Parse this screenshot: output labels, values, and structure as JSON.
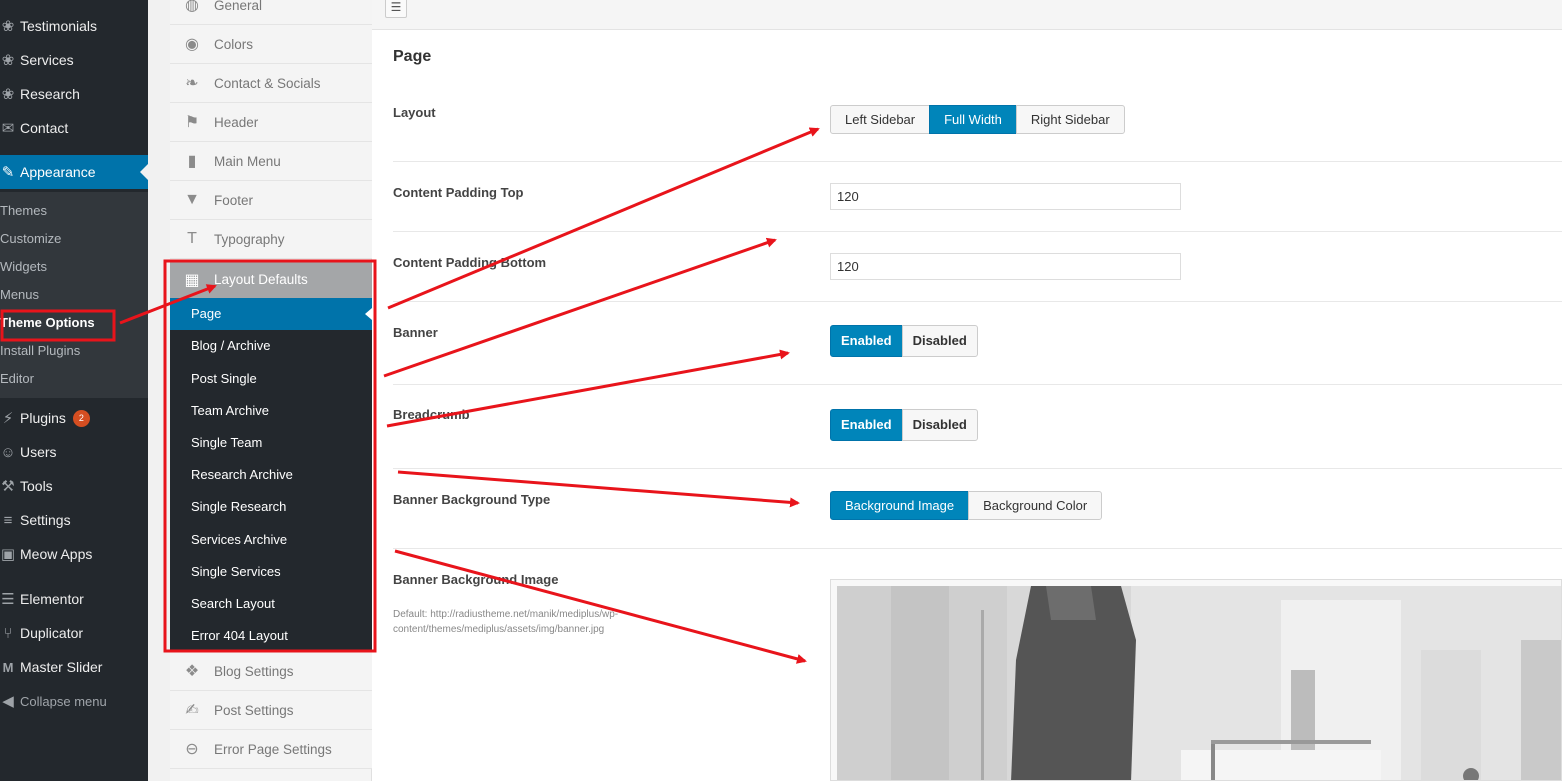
{
  "wp_menu": {
    "items_top": [
      {
        "label": "Testimonials",
        "icon": "award-icon"
      },
      {
        "label": "Services",
        "icon": "award-icon"
      },
      {
        "label": "Research",
        "icon": "award-icon"
      },
      {
        "label": "Contact",
        "icon": "mail-icon"
      }
    ],
    "active": {
      "label": "Appearance",
      "icon": "paintbrush-icon"
    },
    "submenu": [
      "Themes",
      "Customize",
      "Widgets",
      "Menus",
      "Theme Options",
      "Install Plugins",
      "Editor"
    ],
    "submenu_current": "Theme Options",
    "items_bottom": [
      {
        "label": "Plugins",
        "icon": "plug-icon",
        "badge": "2"
      },
      {
        "label": "Users",
        "icon": "user-icon"
      },
      {
        "label": "Tools",
        "icon": "wrench-icon"
      },
      {
        "label": "Settings",
        "icon": "sliders-icon"
      },
      {
        "label": "Meow Apps",
        "icon": "camera-icon"
      },
      {
        "label": "Elementor",
        "icon": "elementor-icon"
      },
      {
        "label": "Duplicator",
        "icon": "share-icon"
      },
      {
        "label": "Master Slider",
        "icon": "m-icon"
      },
      {
        "label": "Collapse menu",
        "icon": "collapse-icon"
      }
    ]
  },
  "options_nav": {
    "items_top": [
      {
        "label": "General",
        "icon": "globe-icon"
      },
      {
        "label": "Colors",
        "icon": "eye-icon"
      },
      {
        "label": "Contact & Socials",
        "icon": "twitter-icon"
      },
      {
        "label": "Header",
        "icon": "flag-icon"
      },
      {
        "label": "Main Menu",
        "icon": "book-icon"
      },
      {
        "label": "Footer",
        "icon": "triangle-down-icon"
      },
      {
        "label": "Typography",
        "icon": "text-icon"
      }
    ],
    "section": {
      "label": "Layout Defaults",
      "icon": "grid-icon"
    },
    "subitems": [
      "Page",
      "Blog / Archive",
      "Post Single",
      "Team Archive",
      "Single Team",
      "Research Archive",
      "Single Research",
      "Services Archive",
      "Single Services",
      "Search Layout",
      "Error 404 Layout"
    ],
    "subitem_current": "Page",
    "items_bottom": [
      {
        "label": "Blog Settings",
        "icon": "tags-icon"
      },
      {
        "label": "Post Settings",
        "icon": "edit-icon"
      },
      {
        "label": "Error Page Settings",
        "icon": "minus-circle-icon"
      }
    ]
  },
  "main": {
    "title": "Page",
    "layout": {
      "label": "Layout",
      "options": [
        "Left Sidebar",
        "Full Width",
        "Right Sidebar"
      ],
      "selected": "Full Width"
    },
    "padding_top": {
      "label": "Content Padding Top",
      "value": "120"
    },
    "padding_bottom": {
      "label": "Content Padding Bottom",
      "value": "120"
    },
    "banner": {
      "label": "Banner",
      "options": [
        "Enabled",
        "Disabled"
      ],
      "selected": "Enabled"
    },
    "breadcrumb": {
      "label": "Breadcrumb",
      "options": [
        "Enabled",
        "Disabled"
      ],
      "selected": "Enabled"
    },
    "banner_bg_type": {
      "label": "Banner Background Type",
      "options": [
        "Background Image",
        "Background Color"
      ],
      "selected": "Background Image"
    },
    "banner_bg_image": {
      "label": "Banner Background Image",
      "desc": "Default: http://radiustheme.net/manik/mediplus/wp-content/themes/mediplus/assets/img/banner.jpg"
    }
  },
  "colors": {
    "wp_sidebar": "#23282d",
    "wp_active": "#0073aa",
    "annotation": "#e8141b",
    "button_on": "#0085ba"
  }
}
